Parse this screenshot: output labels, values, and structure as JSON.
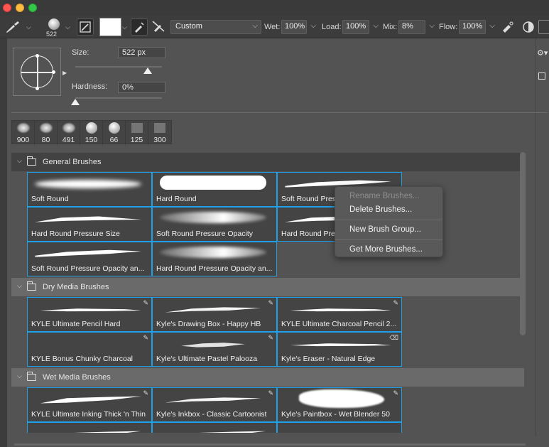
{
  "options_bar": {
    "preset_size": "522",
    "mode": "Custom",
    "wet_label": "Wet:",
    "wet": "100%",
    "load_label": "Load:",
    "load": "100%",
    "mix_label": "Mix:",
    "mix": "8%",
    "flow_label": "Flow:",
    "flow": "100%"
  },
  "settings": {
    "size_label": "Size:",
    "size_value": "522 px",
    "size_fraction": 0.84,
    "hardness_label": "Hardness:",
    "hardness_value": "0%",
    "hardness_fraction": 0.0
  },
  "recent_brushes": [
    "900",
    "80",
    "491",
    "150",
    "66",
    "125",
    "300"
  ],
  "groups": [
    {
      "name": "General Brushes",
      "brushes": [
        "Soft Round",
        "Hard Round",
        "Soft Round Pres",
        "Hard Round Pressure Size",
        "Soft Round Pressure Opacity",
        "Hard Round Pre",
        "Soft Round Pressure Opacity an...",
        "Hard Round Pressure Opacity an..."
      ]
    },
    {
      "name": "Dry Media Brushes",
      "brushes": [
        "KYLE Ultimate Pencil Hard",
        "Kyle's Drawing Box - Happy HB",
        "KYLE Ultimate Charcoal Pencil 2...",
        "KYLE Bonus Chunky Charcoal",
        "Kyle's Ultimate Pastel Palooza",
        "Kyle's Eraser - Natural Edge"
      ]
    },
    {
      "name": "Wet Media Brushes",
      "brushes": [
        "KYLE Ultimate Inking Thick 'n Thin",
        "Kyle's Inkbox - Classic Cartoonist",
        "Kyle's Paintbox - Wet Blender 50"
      ]
    }
  ],
  "context_menu": [
    "Rename Brushes...",
    "Delete Brushes...",
    "New Brush Group...",
    "Get More Brushes..."
  ]
}
